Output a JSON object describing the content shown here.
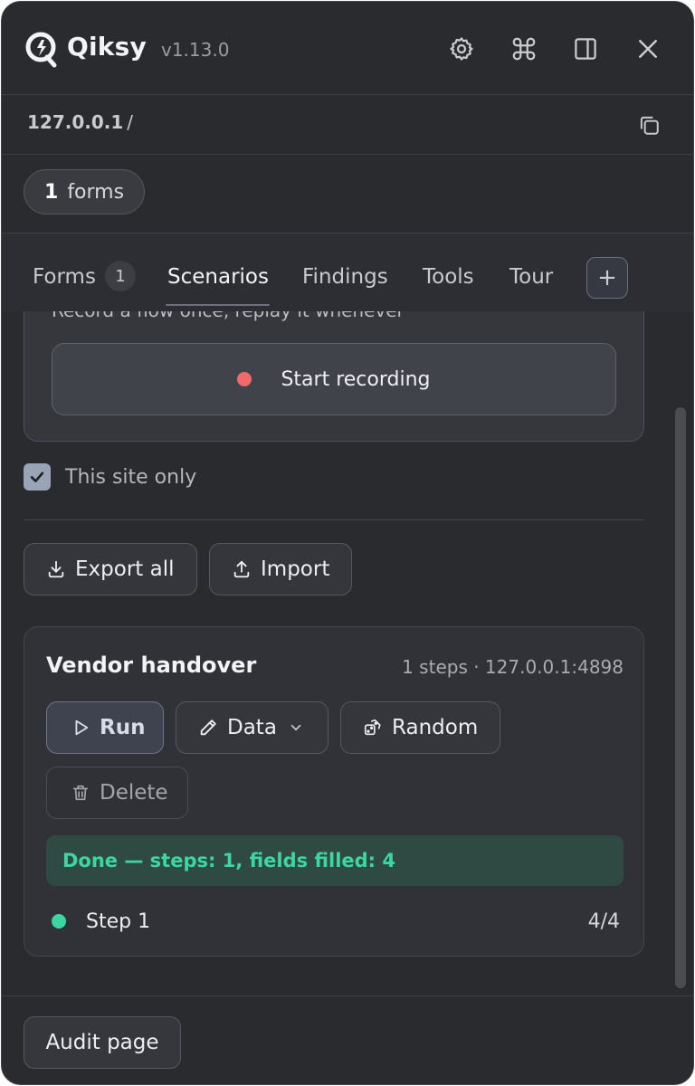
{
  "header": {
    "brand": "Qiksy",
    "version": "v1.13.0",
    "icons": [
      "gear-icon",
      "command-icon",
      "side-panel-icon",
      "close-icon"
    ]
  },
  "url_bar": {
    "host": "127.0.0.1",
    "path": "/"
  },
  "forms_chip": {
    "count": "1",
    "label": "forms"
  },
  "tabs": {
    "items": [
      {
        "label": "Forms",
        "badge": "1"
      },
      {
        "label": "Scenarios"
      },
      {
        "label": "Findings"
      },
      {
        "label": "Tools"
      },
      {
        "label": "Tour"
      }
    ],
    "active": "Scenarios",
    "add_label": "+"
  },
  "recorder": {
    "hint": "Record a flow once, replay it whenever",
    "start_label": "Start recording"
  },
  "site_only": {
    "label": "This site only",
    "checked": true
  },
  "actions": {
    "export_label": "Export all",
    "import_label": "Import"
  },
  "scenario": {
    "title": "Vendor handover",
    "meta": "1 steps · 127.0.0.1:4898",
    "run_label": "Run",
    "data_label": "Data",
    "random_label": "Random",
    "delete_label": "Delete",
    "status": "Done — steps: 1, fields filled: 4",
    "steps": [
      {
        "name": "Step 1",
        "count": "4/4"
      }
    ]
  },
  "footer": {
    "audit_label": "Audit page"
  },
  "colors": {
    "accent_green": "#3dd6a0",
    "record_red": "#f06a6a",
    "panel_bg": "#2a2b2f"
  }
}
